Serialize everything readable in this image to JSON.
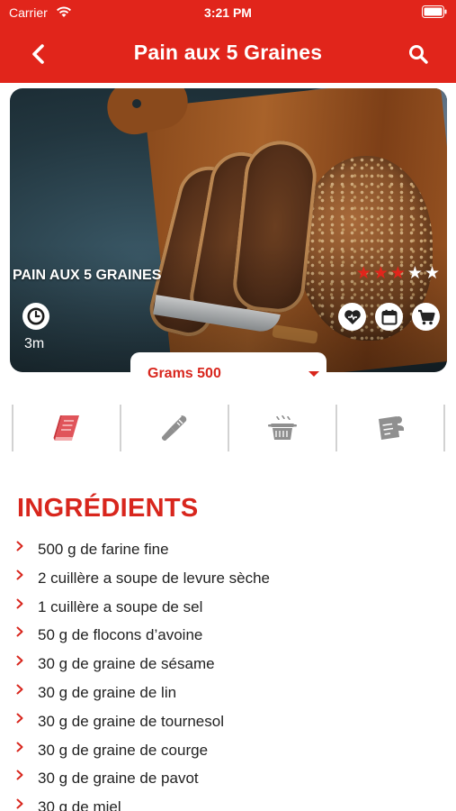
{
  "status_bar": {
    "carrier": "Carrier",
    "time": "3:21 PM"
  },
  "nav": {
    "title": "Pain aux 5 Graines"
  },
  "hero": {
    "title": "PAIN AUX 5 GRAINES",
    "rating": {
      "value": 3,
      "max": 5
    },
    "time": "3m"
  },
  "quantity": {
    "selected": "Grams 500"
  },
  "tabs": [
    {
      "icon": "book-icon"
    },
    {
      "icon": "whisk-icon"
    },
    {
      "icon": "cooking-pot-icon"
    },
    {
      "icon": "notes-icon"
    }
  ],
  "ingredients": {
    "title": "INGRÉDIENTS",
    "items": [
      "500 g de farine fine",
      "2 cuillère a soupe de levure sèche",
      "1 cuillère a soupe de sel",
      "50 g de flocons d’avoine",
      "30 g de graine de sésame",
      "30 g de graine de lin",
      "30 g de graine de tournesol",
      "30 g de graine de courge",
      "30 g de graine de pavot",
      "30 g de miel"
    ]
  },
  "colors": {
    "brand": "#e1251b",
    "accent": "#d8261d",
    "star_active": "#e1251b",
    "star_inactive": "#ffffff",
    "tab_active": "#e0545a",
    "tab_inactive": "#8f8f8f"
  }
}
